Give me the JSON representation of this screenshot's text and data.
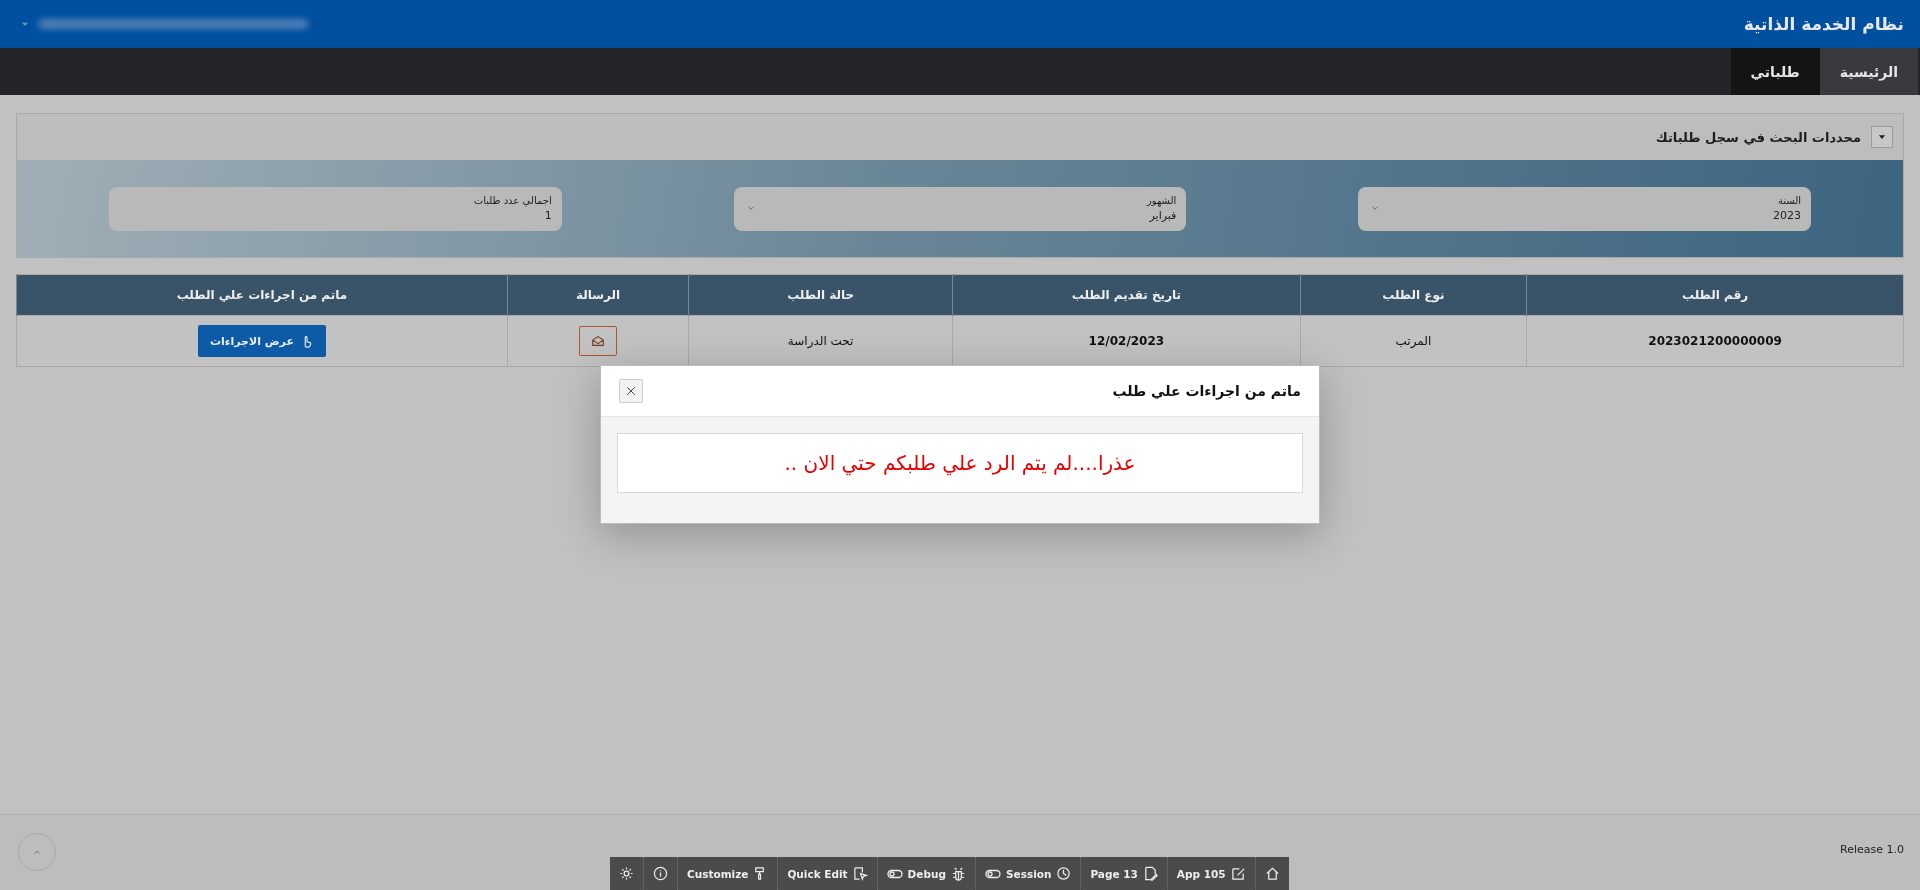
{
  "header": {
    "title": "نظام الخدمة الذاتية"
  },
  "nav": {
    "tabs": [
      {
        "label": "الرئيسية",
        "selected": false
      },
      {
        "label": "طلباتي",
        "selected": true
      }
    ]
  },
  "filters": {
    "title": "محددات البحث في سجل طلباتك",
    "expanded": true,
    "fields": [
      {
        "kind": "select",
        "label": "السنة",
        "value": "2023"
      },
      {
        "kind": "select",
        "label": "الشهور",
        "value": "فبراير"
      },
      {
        "kind": "display",
        "label": "اجمالي عدد طلبات",
        "value": "1"
      }
    ]
  },
  "table": {
    "columns": [
      "رقم الطلب",
      "نوع الطلب",
      "تاريخ تقديم الطلب",
      "حالة الطلب",
      "الرسالة",
      "ماتم من اجراءات علي الطلب"
    ],
    "rows": [
      {
        "cells": [
          "2023021200000009",
          "المرتب",
          "12/02/2023",
          "تحت الدراسة"
        ],
        "action": "عرض الاجراءات"
      }
    ]
  },
  "dialog": {
    "title": "ماتم من اجراءات علي طلب",
    "message": "عذرا....لم يتم الرد علي طلبكم حتي الان .."
  },
  "footer": {
    "release": "Release 1.0"
  },
  "toolbar": {
    "items": [
      {
        "kind": "plain",
        "label": "App 105"
      },
      {
        "kind": "plain",
        "label": "Page 13"
      },
      {
        "kind": "toggle",
        "label": "Session"
      },
      {
        "kind": "toggle",
        "label": "Debug"
      },
      {
        "kind": "plain",
        "label": "Quick Edit"
      },
      {
        "kind": "plain",
        "label": "Customize"
      }
    ]
  }
}
